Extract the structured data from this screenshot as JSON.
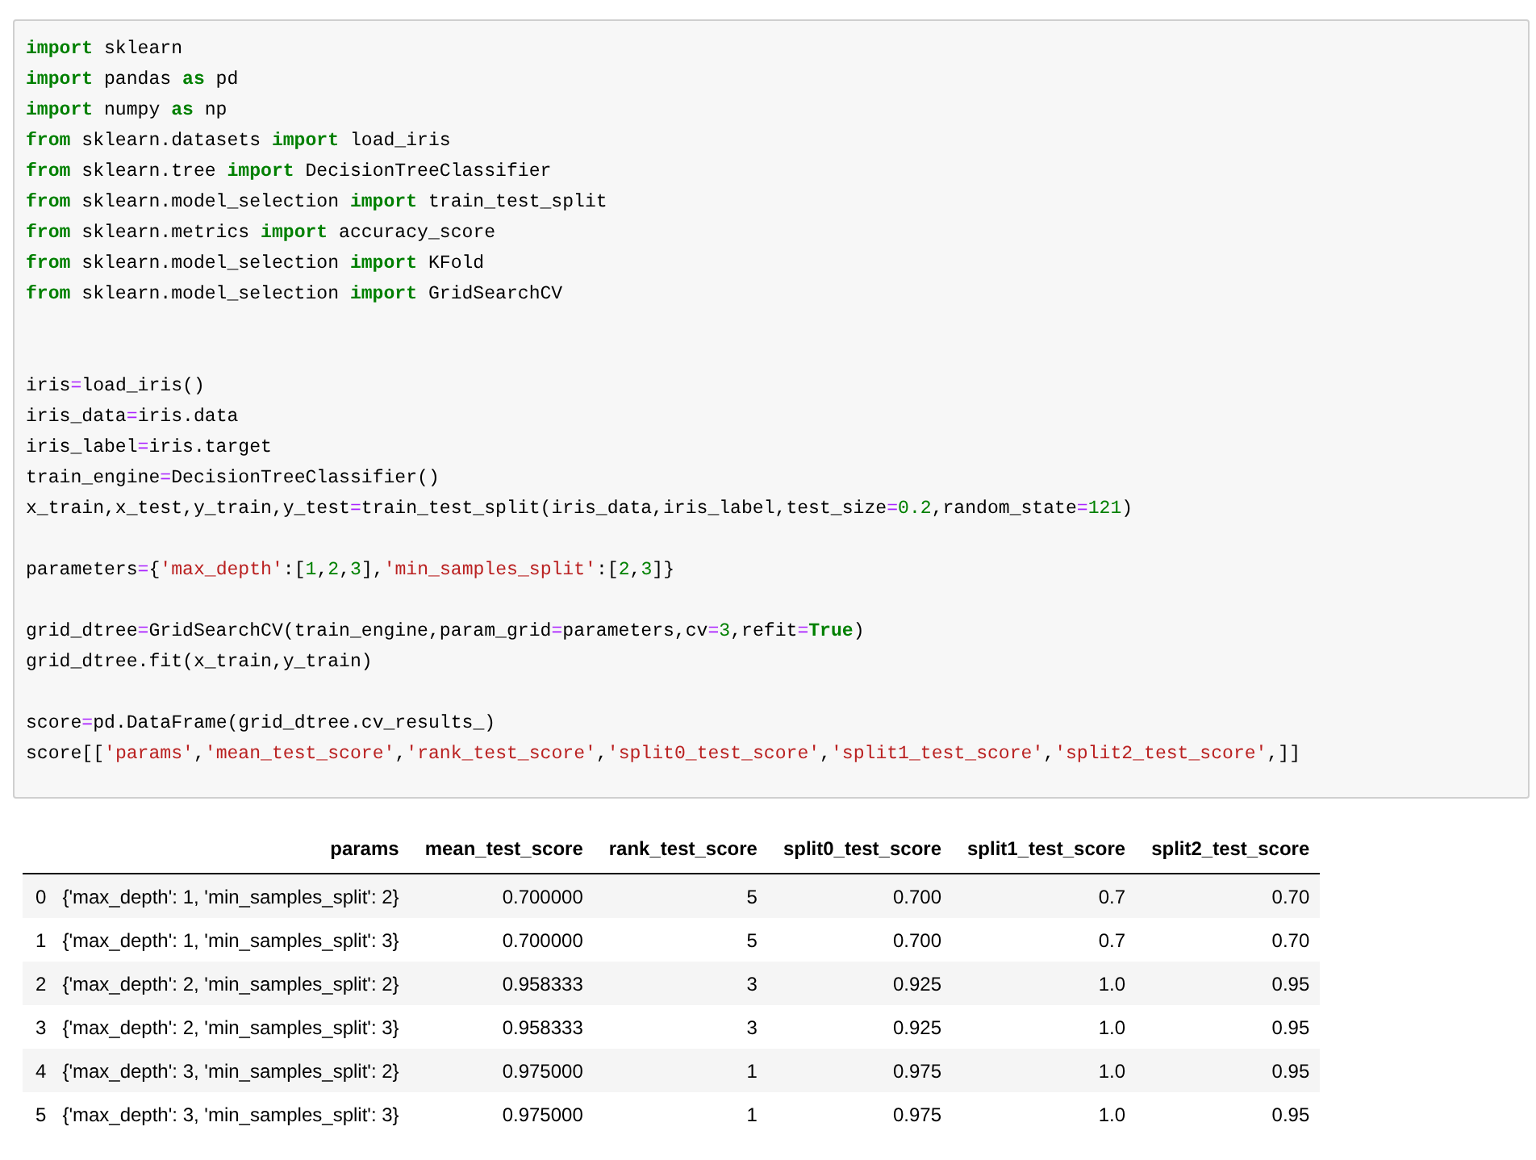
{
  "code_cell": {
    "lines": [
      {
        "kind": "code",
        "tokens": [
          {
            "kind": "kw",
            "text": "import"
          },
          {
            "kind": "name",
            "text": " sklearn"
          }
        ]
      },
      {
        "kind": "code",
        "tokens": [
          {
            "kind": "kw",
            "text": "import"
          },
          {
            "kind": "name",
            "text": " pandas "
          },
          {
            "kind": "kw",
            "text": "as"
          },
          {
            "kind": "name",
            "text": " pd"
          }
        ]
      },
      {
        "kind": "code",
        "tokens": [
          {
            "kind": "kw",
            "text": "import"
          },
          {
            "kind": "name",
            "text": " numpy "
          },
          {
            "kind": "kw",
            "text": "as"
          },
          {
            "kind": "name",
            "text": " np"
          }
        ]
      },
      {
        "kind": "code",
        "tokens": [
          {
            "kind": "kw",
            "text": "from"
          },
          {
            "kind": "name",
            "text": " sklearn.datasets "
          },
          {
            "kind": "kw",
            "text": "import"
          },
          {
            "kind": "name",
            "text": " load_iris"
          }
        ]
      },
      {
        "kind": "code",
        "tokens": [
          {
            "kind": "kw",
            "text": "from"
          },
          {
            "kind": "name",
            "text": " sklearn.tree "
          },
          {
            "kind": "kw",
            "text": "import"
          },
          {
            "kind": "name",
            "text": " DecisionTreeClassifier"
          }
        ]
      },
      {
        "kind": "code",
        "tokens": [
          {
            "kind": "kw",
            "text": "from"
          },
          {
            "kind": "name",
            "text": " sklearn.model_selection "
          },
          {
            "kind": "kw",
            "text": "import"
          },
          {
            "kind": "name",
            "text": " train_test_split"
          }
        ]
      },
      {
        "kind": "code",
        "tokens": [
          {
            "kind": "kw",
            "text": "from"
          },
          {
            "kind": "name",
            "text": " sklearn.metrics "
          },
          {
            "kind": "kw",
            "text": "import"
          },
          {
            "kind": "name",
            "text": " accuracy_score"
          }
        ]
      },
      {
        "kind": "code",
        "tokens": [
          {
            "kind": "kw",
            "text": "from"
          },
          {
            "kind": "name",
            "text": " sklearn.model_selection "
          },
          {
            "kind": "kw",
            "text": "import"
          },
          {
            "kind": "name",
            "text": " KFold"
          }
        ]
      },
      {
        "kind": "code",
        "tokens": [
          {
            "kind": "kw",
            "text": "from"
          },
          {
            "kind": "name",
            "text": " sklearn.model_selection "
          },
          {
            "kind": "kw",
            "text": "import"
          },
          {
            "kind": "name",
            "text": " GridSearchCV"
          }
        ]
      },
      {
        "kind": "blank"
      },
      {
        "kind": "blank"
      },
      {
        "kind": "code",
        "tokens": [
          {
            "kind": "name",
            "text": "iris"
          },
          {
            "kind": "op",
            "text": "="
          },
          {
            "kind": "name",
            "text": "load_iris()"
          }
        ]
      },
      {
        "kind": "code",
        "tokens": [
          {
            "kind": "name",
            "text": "iris_data"
          },
          {
            "kind": "op",
            "text": "="
          },
          {
            "kind": "name",
            "text": "iris.data"
          }
        ]
      },
      {
        "kind": "code",
        "tokens": [
          {
            "kind": "name",
            "text": "iris_label"
          },
          {
            "kind": "op",
            "text": "="
          },
          {
            "kind": "name",
            "text": "iris.target"
          }
        ]
      },
      {
        "kind": "code",
        "tokens": [
          {
            "kind": "name",
            "text": "train_engine"
          },
          {
            "kind": "op",
            "text": "="
          },
          {
            "kind": "name",
            "text": "DecisionTreeClassifier()"
          }
        ]
      },
      {
        "kind": "code",
        "tokens": [
          {
            "kind": "name",
            "text": "x_train,x_test,y_train,y_test"
          },
          {
            "kind": "op",
            "text": "="
          },
          {
            "kind": "name",
            "text": "train_test_split(iris_data,iris_label,test_size"
          },
          {
            "kind": "op",
            "text": "="
          },
          {
            "kind": "num",
            "text": "0.2"
          },
          {
            "kind": "name",
            "text": ",random_state"
          },
          {
            "kind": "op",
            "text": "="
          },
          {
            "kind": "num",
            "text": "121"
          },
          {
            "kind": "name",
            "text": ")"
          }
        ]
      },
      {
        "kind": "blank"
      },
      {
        "kind": "code",
        "tokens": [
          {
            "kind": "name",
            "text": "parameters"
          },
          {
            "kind": "op",
            "text": "="
          },
          {
            "kind": "name",
            "text": "{"
          },
          {
            "kind": "str",
            "text": "'max_depth'"
          },
          {
            "kind": "name",
            "text": ":["
          },
          {
            "kind": "num",
            "text": "1"
          },
          {
            "kind": "name",
            "text": ","
          },
          {
            "kind": "num",
            "text": "2"
          },
          {
            "kind": "name",
            "text": ","
          },
          {
            "kind": "num",
            "text": "3"
          },
          {
            "kind": "name",
            "text": "],"
          },
          {
            "kind": "str",
            "text": "'min_samples_split'"
          },
          {
            "kind": "name",
            "text": ":["
          },
          {
            "kind": "num",
            "text": "2"
          },
          {
            "kind": "name",
            "text": ","
          },
          {
            "kind": "num",
            "text": "3"
          },
          {
            "kind": "name",
            "text": "]}"
          }
        ]
      },
      {
        "kind": "blank"
      },
      {
        "kind": "code",
        "tokens": [
          {
            "kind": "name",
            "text": "grid_dtree"
          },
          {
            "kind": "op",
            "text": "="
          },
          {
            "kind": "name",
            "text": "GridSearchCV(train_engine,param_grid"
          },
          {
            "kind": "op",
            "text": "="
          },
          {
            "kind": "name",
            "text": "parameters,cv"
          },
          {
            "kind": "op",
            "text": "="
          },
          {
            "kind": "num",
            "text": "3"
          },
          {
            "kind": "name",
            "text": ",refit"
          },
          {
            "kind": "op",
            "text": "="
          },
          {
            "kind": "kw",
            "text": "True"
          },
          {
            "kind": "name",
            "text": ")"
          }
        ]
      },
      {
        "kind": "code",
        "tokens": [
          {
            "kind": "name",
            "text": "grid_dtree.fit(x_train,y_train)"
          }
        ]
      },
      {
        "kind": "blank"
      },
      {
        "kind": "code",
        "tokens": [
          {
            "kind": "name",
            "text": "score"
          },
          {
            "kind": "op",
            "text": "="
          },
          {
            "kind": "name",
            "text": "pd.DataFrame(grid_dtree.cv_results_)"
          }
        ]
      },
      {
        "kind": "code",
        "tokens": [
          {
            "kind": "name",
            "text": "score[["
          },
          {
            "kind": "str",
            "text": "'params'"
          },
          {
            "kind": "name",
            "text": ","
          },
          {
            "kind": "str",
            "text": "'mean_test_score'"
          },
          {
            "kind": "name",
            "text": ","
          },
          {
            "kind": "str",
            "text": "'rank_test_score'"
          },
          {
            "kind": "name",
            "text": ","
          },
          {
            "kind": "str",
            "text": "'split0_test_score'"
          },
          {
            "kind": "name",
            "text": ","
          },
          {
            "kind": "str",
            "text": "'split1_test_score'"
          },
          {
            "kind": "name",
            "text": ","
          },
          {
            "kind": "str",
            "text": "'split2_test_score'"
          },
          {
            "kind": "name",
            "text": ",]]"
          }
        ]
      }
    ]
  },
  "output_table": {
    "columns": [
      "params",
      "mean_test_score",
      "rank_test_score",
      "split0_test_score",
      "split1_test_score",
      "split2_test_score"
    ],
    "rows": [
      {
        "index": "0",
        "cells": [
          "{'max_depth': 1, 'min_samples_split': 2}",
          "0.700000",
          "5",
          "0.700",
          "0.7",
          "0.70"
        ]
      },
      {
        "index": "1",
        "cells": [
          "{'max_depth': 1, 'min_samples_split': 3}",
          "0.700000",
          "5",
          "0.700",
          "0.7",
          "0.70"
        ]
      },
      {
        "index": "2",
        "cells": [
          "{'max_depth': 2, 'min_samples_split': 2}",
          "0.958333",
          "3",
          "0.925",
          "1.0",
          "0.95"
        ]
      },
      {
        "index": "3",
        "cells": [
          "{'max_depth': 2, 'min_samples_split': 3}",
          "0.958333",
          "3",
          "0.925",
          "1.0",
          "0.95"
        ]
      },
      {
        "index": "4",
        "cells": [
          "{'max_depth': 3, 'min_samples_split': 2}",
          "0.975000",
          "1",
          "0.975",
          "1.0",
          "0.95"
        ]
      },
      {
        "index": "5",
        "cells": [
          "{'max_depth': 3, 'min_samples_split': 3}",
          "0.975000",
          "1",
          "0.975",
          "1.0",
          "0.95"
        ]
      }
    ]
  }
}
